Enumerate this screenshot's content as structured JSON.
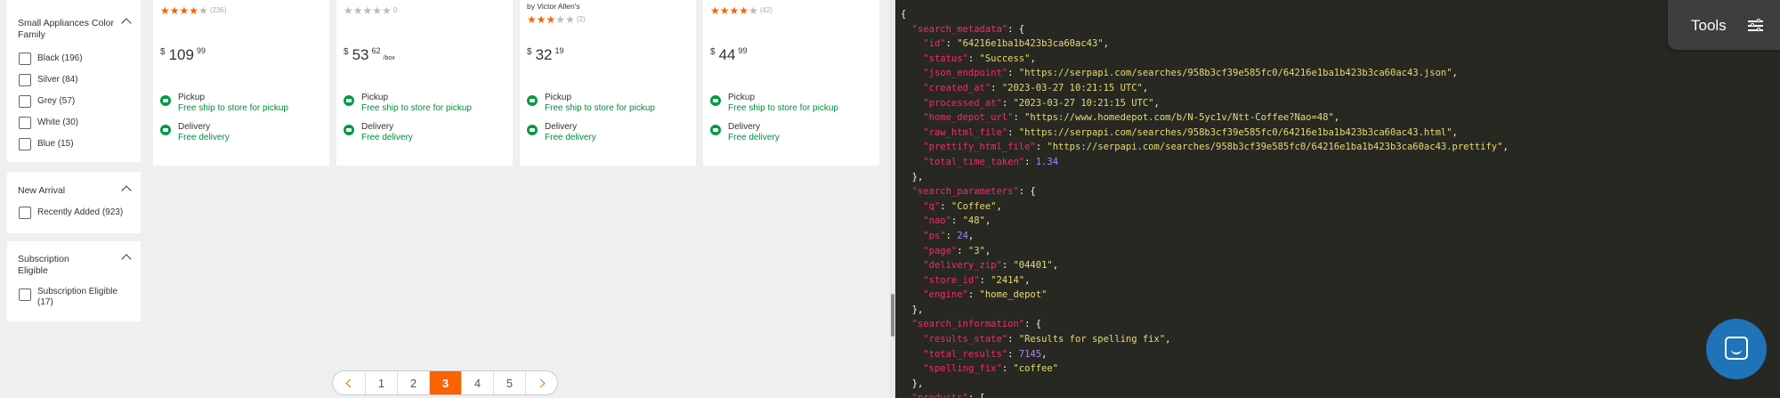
{
  "filters": {
    "color_family": {
      "title": "Small Appliances Color Family",
      "options": [
        "Black (196)",
        "Silver (84)",
        "Grey (57)",
        "White (30)",
        "Blue (15)"
      ]
    },
    "new_arrival": {
      "title": "New Arrival",
      "options": [
        "Recently Added (923)"
      ]
    },
    "subscription": {
      "title": "Subscription Eligible",
      "options": [
        "Subscription Eligible (17)"
      ]
    }
  },
  "products": [
    {
      "byline": "",
      "rating": 4,
      "reviews": "(236)",
      "dollars": "109",
      "cents": "99",
      "unit": "",
      "pickup_label": "Pickup",
      "pickup_sub": "Free ship to store for pickup",
      "delivery_label": "Delivery",
      "delivery_sub": "Free delivery"
    },
    {
      "byline": "",
      "rating": 0,
      "reviews": "0",
      "dollars": "53",
      "cents": "62",
      "unit": "/box",
      "pickup_label": "Pickup",
      "pickup_sub": "Free ship to store for pickup",
      "delivery_label": "Delivery",
      "delivery_sub": "Free delivery"
    },
    {
      "byline": "by Victor Allen's",
      "rating": 3,
      "reviews": "(2)",
      "dollars": "32",
      "cents": "19",
      "unit": "",
      "pickup_label": "Pickup",
      "pickup_sub": "Free ship to store for pickup",
      "delivery_label": "Delivery",
      "delivery_sub": "Free delivery"
    },
    {
      "byline": "",
      "rating": 4,
      "reviews": "(42)",
      "dollars": "44",
      "cents": "99",
      "unit": "",
      "pickup_label": "Pickup",
      "pickup_sub": "Free ship to store for pickup",
      "delivery_label": "Delivery",
      "delivery_sub": "Free delivery"
    }
  ],
  "currency_symbol": "$",
  "pagination": {
    "pages": [
      "1",
      "2",
      "3",
      "4",
      "5"
    ],
    "current": "3"
  },
  "json_view": {
    "lines": [
      [
        {
          "t": "p",
          "v": "{"
        }
      ],
      [
        {
          "t": "p",
          "v": "  "
        },
        {
          "t": "k",
          "v": "\"search_metadata\""
        },
        {
          "t": "p",
          "v": ": {"
        }
      ],
      [
        {
          "t": "p",
          "v": "    "
        },
        {
          "t": "k",
          "v": "\"id\""
        },
        {
          "t": "p",
          "v": ": "
        },
        {
          "t": "s",
          "v": "\"64216e1ba1b423b3ca60ac43\""
        },
        {
          "t": "p",
          "v": ","
        }
      ],
      [
        {
          "t": "p",
          "v": "    "
        },
        {
          "t": "k",
          "v": "\"status\""
        },
        {
          "t": "p",
          "v": ": "
        },
        {
          "t": "s",
          "v": "\"Success\""
        },
        {
          "t": "p",
          "v": ","
        }
      ],
      [
        {
          "t": "p",
          "v": "    "
        },
        {
          "t": "k",
          "v": "\"json_endpoint\""
        },
        {
          "t": "p",
          "v": ": "
        },
        {
          "t": "s",
          "v": "\"https://serpapi.com/searches/958b3cf39e585fc0/64216e1ba1b423b3ca60ac43.json\""
        },
        {
          "t": "p",
          "v": ","
        }
      ],
      [
        {
          "t": "p",
          "v": "    "
        },
        {
          "t": "k",
          "v": "\"created_at\""
        },
        {
          "t": "p",
          "v": ": "
        },
        {
          "t": "s",
          "v": "\"2023-03-27 10:21:15 UTC\""
        },
        {
          "t": "p",
          "v": ","
        }
      ],
      [
        {
          "t": "p",
          "v": "    "
        },
        {
          "t": "k",
          "v": "\"processed_at\""
        },
        {
          "t": "p",
          "v": ": "
        },
        {
          "t": "s",
          "v": "\"2023-03-27 10:21:15 UTC\""
        },
        {
          "t": "p",
          "v": ","
        }
      ],
      [
        {
          "t": "p",
          "v": "    "
        },
        {
          "t": "k",
          "v": "\"home_depot_url\""
        },
        {
          "t": "p",
          "v": ": "
        },
        {
          "t": "s",
          "v": "\"https://www.homedepot.com/b/N-5yc1v/Ntt-Coffee?Nao=48\""
        },
        {
          "t": "p",
          "v": ","
        }
      ],
      [
        {
          "t": "p",
          "v": "    "
        },
        {
          "t": "k",
          "v": "\"raw_html_file\""
        },
        {
          "t": "p",
          "v": ": "
        },
        {
          "t": "s",
          "v": "\"https://serpapi.com/searches/958b3cf39e585fc0/64216e1ba1b423b3ca60ac43.html\""
        },
        {
          "t": "p",
          "v": ","
        }
      ],
      [
        {
          "t": "p",
          "v": "    "
        },
        {
          "t": "k",
          "v": "\"prettify_html_file\""
        },
        {
          "t": "p",
          "v": ": "
        },
        {
          "t": "s",
          "v": "\"https://serpapi.com/searches/958b3cf39e585fc0/64216e1ba1b423b3ca60ac43.prettify\""
        },
        {
          "t": "p",
          "v": ","
        }
      ],
      [
        {
          "t": "p",
          "v": "    "
        },
        {
          "t": "k",
          "v": "\"total_time_taken\""
        },
        {
          "t": "p",
          "v": ": "
        },
        {
          "t": "n",
          "v": "1.34"
        }
      ],
      [
        {
          "t": "p",
          "v": "  },"
        }
      ],
      [
        {
          "t": "p",
          "v": "  "
        },
        {
          "t": "k",
          "v": "\"search_parameters\""
        },
        {
          "t": "p",
          "v": ": {"
        }
      ],
      [
        {
          "t": "p",
          "v": "    "
        },
        {
          "t": "k",
          "v": "\"q\""
        },
        {
          "t": "p",
          "v": ": "
        },
        {
          "t": "s",
          "v": "\"Coffee\""
        },
        {
          "t": "p",
          "v": ","
        }
      ],
      [
        {
          "t": "p",
          "v": "    "
        },
        {
          "t": "k",
          "v": "\"nao\""
        },
        {
          "t": "p",
          "v": ": "
        },
        {
          "t": "s",
          "v": "\"48\""
        },
        {
          "t": "p",
          "v": ","
        }
      ],
      [
        {
          "t": "p",
          "v": "    "
        },
        {
          "t": "k",
          "v": "\"ps\""
        },
        {
          "t": "p",
          "v": ": "
        },
        {
          "t": "n",
          "v": "24"
        },
        {
          "t": "p",
          "v": ","
        }
      ],
      [
        {
          "t": "p",
          "v": "    "
        },
        {
          "t": "k",
          "v": "\"page\""
        },
        {
          "t": "p",
          "v": ": "
        },
        {
          "t": "s",
          "v": "\"3\""
        },
        {
          "t": "p",
          "v": ","
        }
      ],
      [
        {
          "t": "p",
          "v": "    "
        },
        {
          "t": "k",
          "v": "\"delivery_zip\""
        },
        {
          "t": "p",
          "v": ": "
        },
        {
          "t": "s",
          "v": "\"04401\""
        },
        {
          "t": "p",
          "v": ","
        }
      ],
      [
        {
          "t": "p",
          "v": "    "
        },
        {
          "t": "k",
          "v": "\"store_id\""
        },
        {
          "t": "p",
          "v": ": "
        },
        {
          "t": "s",
          "v": "\"2414\""
        },
        {
          "t": "p",
          "v": ","
        }
      ],
      [
        {
          "t": "p",
          "v": "    "
        },
        {
          "t": "k",
          "v": "\"engine\""
        },
        {
          "t": "p",
          "v": ": "
        },
        {
          "t": "s",
          "v": "\"home_depot\""
        }
      ],
      [
        {
          "t": "p",
          "v": "  },"
        }
      ],
      [
        {
          "t": "p",
          "v": "  "
        },
        {
          "t": "k",
          "v": "\"search_information\""
        },
        {
          "t": "p",
          "v": ": {"
        }
      ],
      [
        {
          "t": "p",
          "v": "    "
        },
        {
          "t": "k",
          "v": "\"results_state\""
        },
        {
          "t": "p",
          "v": ": "
        },
        {
          "t": "s",
          "v": "\"Results for spelling fix\""
        },
        {
          "t": "p",
          "v": ","
        }
      ],
      [
        {
          "t": "p",
          "v": "    "
        },
        {
          "t": "k",
          "v": "\"total_results\""
        },
        {
          "t": "p",
          "v": ": "
        },
        {
          "t": "n",
          "v": "7145"
        },
        {
          "t": "p",
          "v": ","
        }
      ],
      [
        {
          "t": "p",
          "v": "    "
        },
        {
          "t": "k",
          "v": "\"spelling_fix\""
        },
        {
          "t": "p",
          "v": ": "
        },
        {
          "t": "s",
          "v": "\"coffee\""
        }
      ],
      [
        {
          "t": "p",
          "v": "  },"
        }
      ],
      [
        {
          "t": "p",
          "v": "  "
        },
        {
          "t": "k",
          "v": "\"products\""
        },
        {
          "t": "p",
          "v": ": ["
        }
      ]
    ]
  },
  "tools": {
    "label": "Tools",
    "icon": "sliders-icon"
  },
  "chat": {
    "icon": "chat-bubble-icon"
  },
  "colors": {
    "accent": "#f96302",
    "delivery_green": "#008c3c",
    "json_bg": "#272822",
    "chat_blue": "#1f73b7"
  }
}
